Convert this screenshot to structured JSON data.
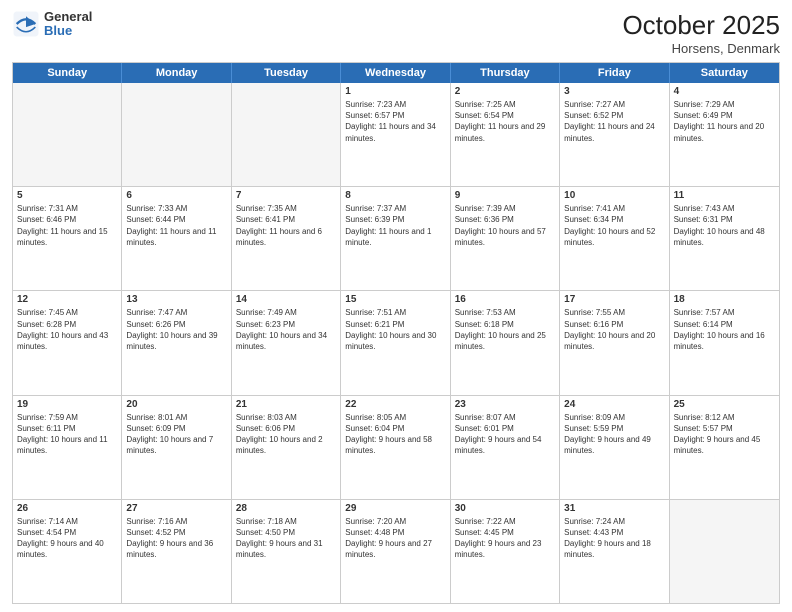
{
  "header": {
    "logo": {
      "general": "General",
      "blue": "Blue"
    },
    "month": "October 2025",
    "location": "Horsens, Denmark"
  },
  "weekdays": [
    "Sunday",
    "Monday",
    "Tuesday",
    "Wednesday",
    "Thursday",
    "Friday",
    "Saturday"
  ],
  "rows": [
    [
      {
        "day": "",
        "empty": true
      },
      {
        "day": "",
        "empty": true
      },
      {
        "day": "",
        "empty": true
      },
      {
        "day": "1",
        "sunrise": "7:23 AM",
        "sunset": "6:57 PM",
        "daylight": "11 hours and 34 minutes."
      },
      {
        "day": "2",
        "sunrise": "7:25 AM",
        "sunset": "6:54 PM",
        "daylight": "11 hours and 29 minutes."
      },
      {
        "day": "3",
        "sunrise": "7:27 AM",
        "sunset": "6:52 PM",
        "daylight": "11 hours and 24 minutes."
      },
      {
        "day": "4",
        "sunrise": "7:29 AM",
        "sunset": "6:49 PM",
        "daylight": "11 hours and 20 minutes."
      }
    ],
    [
      {
        "day": "5",
        "sunrise": "7:31 AM",
        "sunset": "6:46 PM",
        "daylight": "11 hours and 15 minutes."
      },
      {
        "day": "6",
        "sunrise": "7:33 AM",
        "sunset": "6:44 PM",
        "daylight": "11 hours and 11 minutes."
      },
      {
        "day": "7",
        "sunrise": "7:35 AM",
        "sunset": "6:41 PM",
        "daylight": "11 hours and 6 minutes."
      },
      {
        "day": "8",
        "sunrise": "7:37 AM",
        "sunset": "6:39 PM",
        "daylight": "11 hours and 1 minute."
      },
      {
        "day": "9",
        "sunrise": "7:39 AM",
        "sunset": "6:36 PM",
        "daylight": "10 hours and 57 minutes."
      },
      {
        "day": "10",
        "sunrise": "7:41 AM",
        "sunset": "6:34 PM",
        "daylight": "10 hours and 52 minutes."
      },
      {
        "day": "11",
        "sunrise": "7:43 AM",
        "sunset": "6:31 PM",
        "daylight": "10 hours and 48 minutes."
      }
    ],
    [
      {
        "day": "12",
        "sunrise": "7:45 AM",
        "sunset": "6:28 PM",
        "daylight": "10 hours and 43 minutes."
      },
      {
        "day": "13",
        "sunrise": "7:47 AM",
        "sunset": "6:26 PM",
        "daylight": "10 hours and 39 minutes."
      },
      {
        "day": "14",
        "sunrise": "7:49 AM",
        "sunset": "6:23 PM",
        "daylight": "10 hours and 34 minutes."
      },
      {
        "day": "15",
        "sunrise": "7:51 AM",
        "sunset": "6:21 PM",
        "daylight": "10 hours and 30 minutes."
      },
      {
        "day": "16",
        "sunrise": "7:53 AM",
        "sunset": "6:18 PM",
        "daylight": "10 hours and 25 minutes."
      },
      {
        "day": "17",
        "sunrise": "7:55 AM",
        "sunset": "6:16 PM",
        "daylight": "10 hours and 20 minutes."
      },
      {
        "day": "18",
        "sunrise": "7:57 AM",
        "sunset": "6:14 PM",
        "daylight": "10 hours and 16 minutes."
      }
    ],
    [
      {
        "day": "19",
        "sunrise": "7:59 AM",
        "sunset": "6:11 PM",
        "daylight": "10 hours and 11 minutes."
      },
      {
        "day": "20",
        "sunrise": "8:01 AM",
        "sunset": "6:09 PM",
        "daylight": "10 hours and 7 minutes."
      },
      {
        "day": "21",
        "sunrise": "8:03 AM",
        "sunset": "6:06 PM",
        "daylight": "10 hours and 2 minutes."
      },
      {
        "day": "22",
        "sunrise": "8:05 AM",
        "sunset": "6:04 PM",
        "daylight": "9 hours and 58 minutes."
      },
      {
        "day": "23",
        "sunrise": "8:07 AM",
        "sunset": "6:01 PM",
        "daylight": "9 hours and 54 minutes."
      },
      {
        "day": "24",
        "sunrise": "8:09 AM",
        "sunset": "5:59 PM",
        "daylight": "9 hours and 49 minutes."
      },
      {
        "day": "25",
        "sunrise": "8:12 AM",
        "sunset": "5:57 PM",
        "daylight": "9 hours and 45 minutes."
      }
    ],
    [
      {
        "day": "26",
        "sunrise": "7:14 AM",
        "sunset": "4:54 PM",
        "daylight": "9 hours and 40 minutes."
      },
      {
        "day": "27",
        "sunrise": "7:16 AM",
        "sunset": "4:52 PM",
        "daylight": "9 hours and 36 minutes."
      },
      {
        "day": "28",
        "sunrise": "7:18 AM",
        "sunset": "4:50 PM",
        "daylight": "9 hours and 31 minutes."
      },
      {
        "day": "29",
        "sunrise": "7:20 AM",
        "sunset": "4:48 PM",
        "daylight": "9 hours and 27 minutes."
      },
      {
        "day": "30",
        "sunrise": "7:22 AM",
        "sunset": "4:45 PM",
        "daylight": "9 hours and 23 minutes."
      },
      {
        "day": "31",
        "sunrise": "7:24 AM",
        "sunset": "4:43 PM",
        "daylight": "9 hours and 18 minutes."
      },
      {
        "day": "",
        "empty": true
      }
    ]
  ]
}
